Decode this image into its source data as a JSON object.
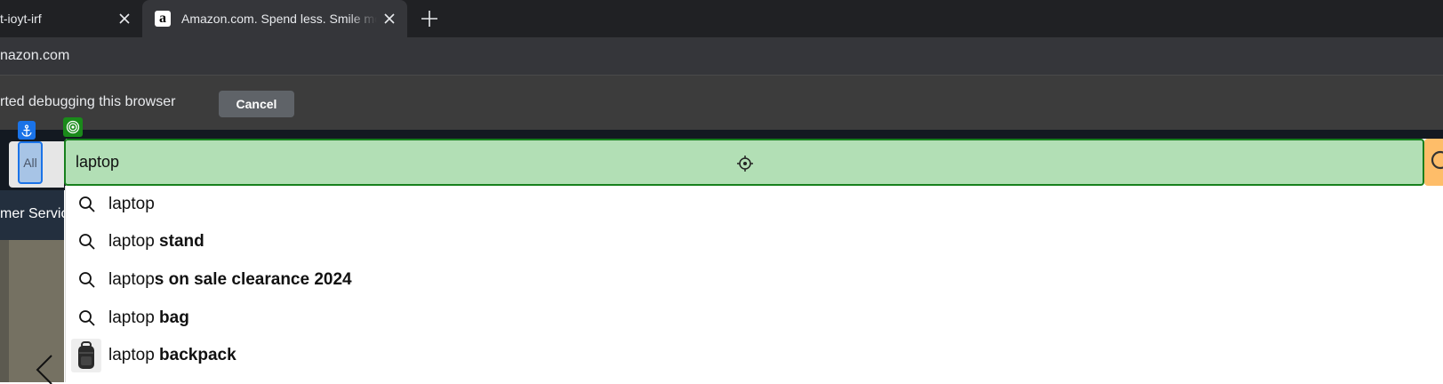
{
  "browser": {
    "tabs": [
      {
        "title": "t-ioyt-irf"
      },
      {
        "title": "Amazon.com. Spend less. Smile more."
      }
    ],
    "address_url": "nazon.com",
    "infobar_text": "rted debugging this browser",
    "cancel_label": "Cancel"
  },
  "amazon": {
    "category_label": "All",
    "search_value": "laptop",
    "nav_partial": "mer Servic",
    "suggestions": [
      {
        "prefix": "laptop",
        "suffix": ""
      },
      {
        "prefix": "laptop",
        "suffix": " stand"
      },
      {
        "prefix": "laptop",
        "suffix": "s on sale clearance 2024"
      },
      {
        "prefix": "laptop",
        "suffix": " bag"
      },
      {
        "prefix": "laptop",
        "suffix": " backpack"
      }
    ]
  },
  "colors": {
    "highlight_green": "#b2dfb5",
    "highlight_border": "#17801d",
    "anchor_blue": "#1a73e8"
  }
}
